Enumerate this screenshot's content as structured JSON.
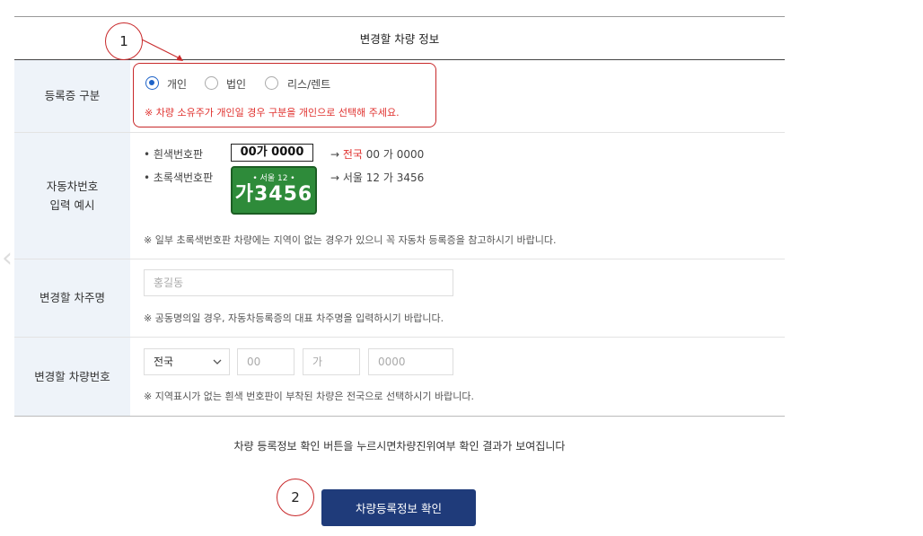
{
  "table_title": "변경할 차량 정보",
  "rows": {
    "registration_type": {
      "label": "등록증 구분",
      "options": [
        "개인",
        "법인",
        "리스/렌트"
      ],
      "selected": "개인",
      "warning": "※ 차량 소유주가 개인일 경우 구분을 개인으로 선택해 주세요."
    },
    "plate_example": {
      "label_line1": "자동차번호",
      "label_line2": "입력 예시",
      "white_plate_label": "• 흰색번호판",
      "white_plate_text": "00가 0000",
      "white_arrow_prefix": "→ ",
      "white_arrow_red": "전국",
      "white_arrow_rest": " 00 가 0000",
      "green_plate_label": "• 초록색번호판",
      "green_plate_top": "•  서울 12  •",
      "green_plate_bottom": "가3456",
      "green_arrow": "→ 서울 12 가 3456",
      "note": "※ 일부 초록색번호판 차량에는 지역이 없는 경우가 있으니 꼭 자동차 등록증을 참고하시기 바랍니다."
    },
    "owner_name": {
      "label": "변경할 차주명",
      "placeholder": "홍길동",
      "note": "※ 공동명의일 경우, 자동차등록증의 대표 차주명을 입력하시기 바랍니다."
    },
    "car_number": {
      "label": "변경할 차량번호",
      "region_select": "전국",
      "placeholder_num1": "00",
      "placeholder_char": "가",
      "placeholder_num2": "0000",
      "note": "※ 지역표시가 없는 흰색 번호판이 부착된 차량은 전국으로 선택하시기 바랍니다."
    }
  },
  "info_text": "차량 등록정보 확인 버튼을 누르시면차량진위여부 확인 결과가 보여집니다",
  "submit_label": "차량등록정보 확인",
  "annotations": [
    "1",
    "2"
  ],
  "colors": {
    "accent": "#1e63c8",
    "button": "#1f3b7a",
    "warning": "#e0322f",
    "annotation": "#c8282a",
    "label_bg": "#eef3f9",
    "plate_green": "#2e8b3a"
  }
}
